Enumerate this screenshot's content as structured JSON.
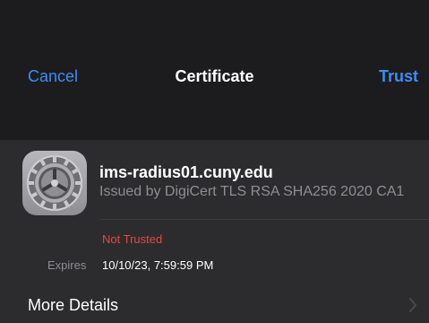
{
  "nav": {
    "cancel_label": "Cancel",
    "title": "Certificate",
    "trust_label": "Trust"
  },
  "certificate": {
    "icon": "settings-gear-icon",
    "name": "ims-radius01.cuny.edu",
    "issuer": "Issued by DigiCert TLS RSA SHA256 2020 CA1",
    "status": "Not Trusted",
    "expires_label": "Expires",
    "expires_value": "10/10/23, 7:59:59 PM"
  },
  "more_details": {
    "label": "More Details",
    "icon": "chevron-right-icon"
  },
  "colors": {
    "accent": "#3e8cf6",
    "danger": "#e5483f",
    "secondary_text": "#8e8e93",
    "nav_background": "#1c1c1e",
    "card_background": "#2c2c2e"
  }
}
